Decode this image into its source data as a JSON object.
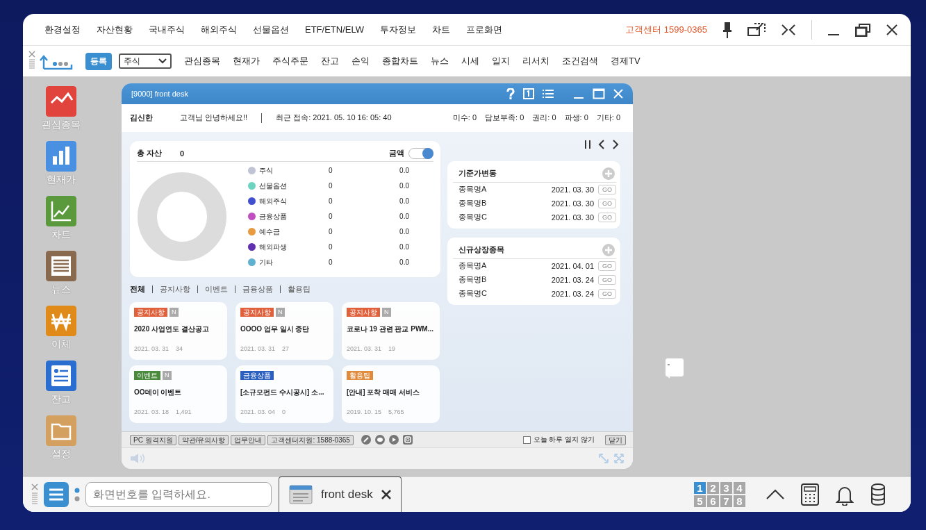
{
  "menu_bar": {
    "items": [
      "환경설정",
      "자산현황",
      "국내주식",
      "해외주식",
      "선물옵션",
      "ETF/ETN/ELW",
      "투자정보",
      "차트",
      "프로화면"
    ],
    "support": "고객센터 1599-0365"
  },
  "toolbar": {
    "register": "등록",
    "dropdown": "주식",
    "items": [
      "관심종목",
      "현재가",
      "주식주문",
      "잔고",
      "손익",
      "종합차트",
      "뉴스",
      "시세",
      "일지",
      "리서치",
      "조건검색",
      "경제TV"
    ]
  },
  "sidebar": [
    {
      "label": "관심종목",
      "color": "#e0443c"
    },
    {
      "label": "현재가",
      "color": "#4a90e2"
    },
    {
      "label": "차트",
      "color": "#5a9a3c"
    },
    {
      "label": "뉴스",
      "color": "#8a6a4e"
    },
    {
      "label": "이체",
      "color": "#e08a1a"
    },
    {
      "label": "잔고",
      "color": "#2a6fd0"
    },
    {
      "label": "설정",
      "color": "#d4a060"
    }
  ],
  "window": {
    "title": "[9000] front desk",
    "user": "김신한",
    "greeting": "고객님 안녕하세요!!",
    "last_access": "최근 접속: 2021. 05. 10 16: 05: 40",
    "stats": [
      "미수: 0",
      "담보부족: 0",
      "권리: 0",
      "파생: 0",
      "기타: 0"
    ]
  },
  "assets": {
    "label": "총 자산",
    "value": "0",
    "toggle_label": "금액",
    "toggle_on": true,
    "legend": [
      {
        "name": "주식",
        "color": "#c0c4d4",
        "amount": "0",
        "percent": "0.0"
      },
      {
        "name": "선물옵션",
        "color": "#6cd4c0",
        "amount": "0",
        "percent": "0.0"
      },
      {
        "name": "해외주식",
        "color": "#4050d0",
        "amount": "0",
        "percent": "0.0"
      },
      {
        "name": "금융상품",
        "color": "#c050c0",
        "amount": "0",
        "percent": "0.0"
      },
      {
        "name": "예수금",
        "color": "#e89a40",
        "amount": "0",
        "percent": "0.0"
      },
      {
        "name": "해외파생",
        "color": "#6030b0",
        "amount": "0",
        "percent": "0.0"
      },
      {
        "name": "기타",
        "color": "#60b0d0",
        "amount": "0",
        "percent": "0.0"
      }
    ]
  },
  "news_tabs": [
    {
      "label": "전체",
      "selected": true
    },
    {
      "label": "공지사항",
      "selected": false
    },
    {
      "label": "이벤트",
      "selected": false
    },
    {
      "label": "금융상품",
      "selected": false
    },
    {
      "label": "활용팁",
      "selected": false
    }
  ],
  "news_cards": [
    {
      "tag": "공지사항",
      "color": "#e0603c",
      "badge": "N",
      "title": "2020 사업연도 결산공고",
      "date": "2021. 03. 31",
      "views": "34"
    },
    {
      "tag": "공지사항",
      "color": "#e0603c",
      "badge": "N",
      "title": "OOOO 업무 일시 중단",
      "date": "2021. 03. 31",
      "views": "27"
    },
    {
      "tag": "공지사항",
      "color": "#e0603c",
      "badge": "N",
      "title": "코로나 19 관련 판교 PWM...",
      "date": "2021. 03. 31",
      "views": "19"
    },
    {
      "tag": "이벤트",
      "color": "#4a8a3c",
      "badge": "N",
      "title": "OO데이 이벤트",
      "date": "2021. 03. 18",
      "views": "1,491"
    },
    {
      "tag": "금융상품",
      "color": "#2a5fc0",
      "title": "[소규모펀드 수시공시] 소...",
      "date": "2021. 03. 04",
      "views": "0"
    },
    {
      "tag": "활용팁",
      "color": "#e08a3c",
      "title": "[안내] 포착 매매 서비스",
      "date": "2019. 10. 15",
      "views": "5,765"
    }
  ],
  "side_panels": [
    {
      "title": "기준가변동",
      "rows": [
        {
          "name": "종목명A",
          "date": "2021. 03. 30",
          "button": "GO"
        },
        {
          "name": "종목명B",
          "date": "2021. 03. 30",
          "button": "GO"
        },
        {
          "name": "종목명C",
          "date": "2021. 03. 30",
          "button": "GO"
        }
      ]
    },
    {
      "title": "신규상장종목",
      "rows": [
        {
          "name": "종목명A",
          "date": "2021. 04. 01",
          "button": "GO"
        },
        {
          "name": "종목명B",
          "date": "2021. 03. 24",
          "button": "GO"
        },
        {
          "name": "종목명C",
          "date": "2021. 03. 24",
          "button": "GO"
        }
      ]
    }
  ],
  "footer": {
    "links": [
      "PC 원격지원",
      "약관/유의사항",
      "업무안내",
      "고객센터지원: 1588-0365"
    ],
    "checkbox": {
      "label": "오늘 하루 열지 않기",
      "checked": false
    },
    "close": "닫기"
  },
  "taskbar": {
    "placeholder": "화면번호를 입력하세요.",
    "tab": "front desk",
    "screens": [
      {
        "label": "1",
        "selected": true
      },
      {
        "label": "2",
        "selected": false
      },
      {
        "label": "3",
        "selected": false
      },
      {
        "label": "4",
        "selected": false
      },
      {
        "label": "5",
        "selected": false
      },
      {
        "label": "6",
        "selected": false
      },
      {
        "label": "7",
        "selected": false
      },
      {
        "label": "8",
        "selected": false
      }
    ]
  }
}
